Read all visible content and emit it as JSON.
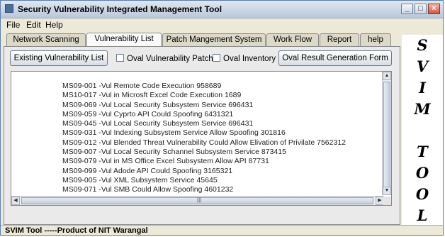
{
  "window": {
    "title": "Security Vulnerability Integrated Management Tool",
    "controls": {
      "minimize": "_",
      "maximize": "□",
      "close": "×"
    }
  },
  "menubar": {
    "items": [
      "File",
      "Edit",
      "Help"
    ]
  },
  "tabs": [
    {
      "label": "Network Scanning",
      "active": false
    },
    {
      "label": "Vulnerability List",
      "active": true
    },
    {
      "label": "Patch Mangement System",
      "active": false
    },
    {
      "label": "Work Flow",
      "active": false
    },
    {
      "label": "Report",
      "active": false
    },
    {
      "label": "help",
      "active": false
    }
  ],
  "toolbar": {
    "existing_button": "Existing Vulnerability List",
    "oval_patch_checkbox": "Oval Vulnerability Patch",
    "oval_inventory_checkbox": "Oval Inventory",
    "oval_result_button": "Oval Result Generation Form"
  },
  "vulnerability_list": [
    "MS09-001 -Vul Remote Code Execution 958689",
    "MS10-017 -Vul in Microsft Excel Code Execution 1689",
    "MS09-069 -Vul Local Security Subsystem Service 696431",
    "MS09-059 -Vul Cyprto API Could Spoofing 6431321",
    "MS09-045 -Vul Local Security Subsystem Service 696431",
    "MS09-031 -Vul Indexing Subsystem Service Allow Spoofing 301816",
    "MS09-012 -Vul Blended Threat Vulnerability Could Allow Elivation of Privilate 7562312",
    "MS09-007 -Vul Local Security Schannel Subsystem Service 873415",
    "MS09-079 -Vul in MS Office Excel Subsystem Allow API 87731",
    "MS09-099 -Vul Adode API Could Spoofing 3165321",
    "MS09-005 -Vul XML Subsystem Service 45645",
    "MS09-071 -Vul SMB Could Allow Spoofing 4601232"
  ],
  "side_banner": {
    "letters": [
      "S",
      "V",
      "I",
      "M",
      "T",
      "O",
      "O",
      "L"
    ]
  },
  "status": {
    "text": "SVIM Tool  -----Product of NIT Warangal"
  },
  "colors": {
    "chrome": "#ece9d8",
    "accent": "#4a6f9c",
    "close_button": "#d2573d"
  },
  "icons": {
    "app": "app-icon",
    "scroll_up": "arrow-up-icon",
    "scroll_down": "arrow-down-icon",
    "scroll_left": "arrow-left-icon",
    "scroll_right": "arrow-right-icon"
  }
}
